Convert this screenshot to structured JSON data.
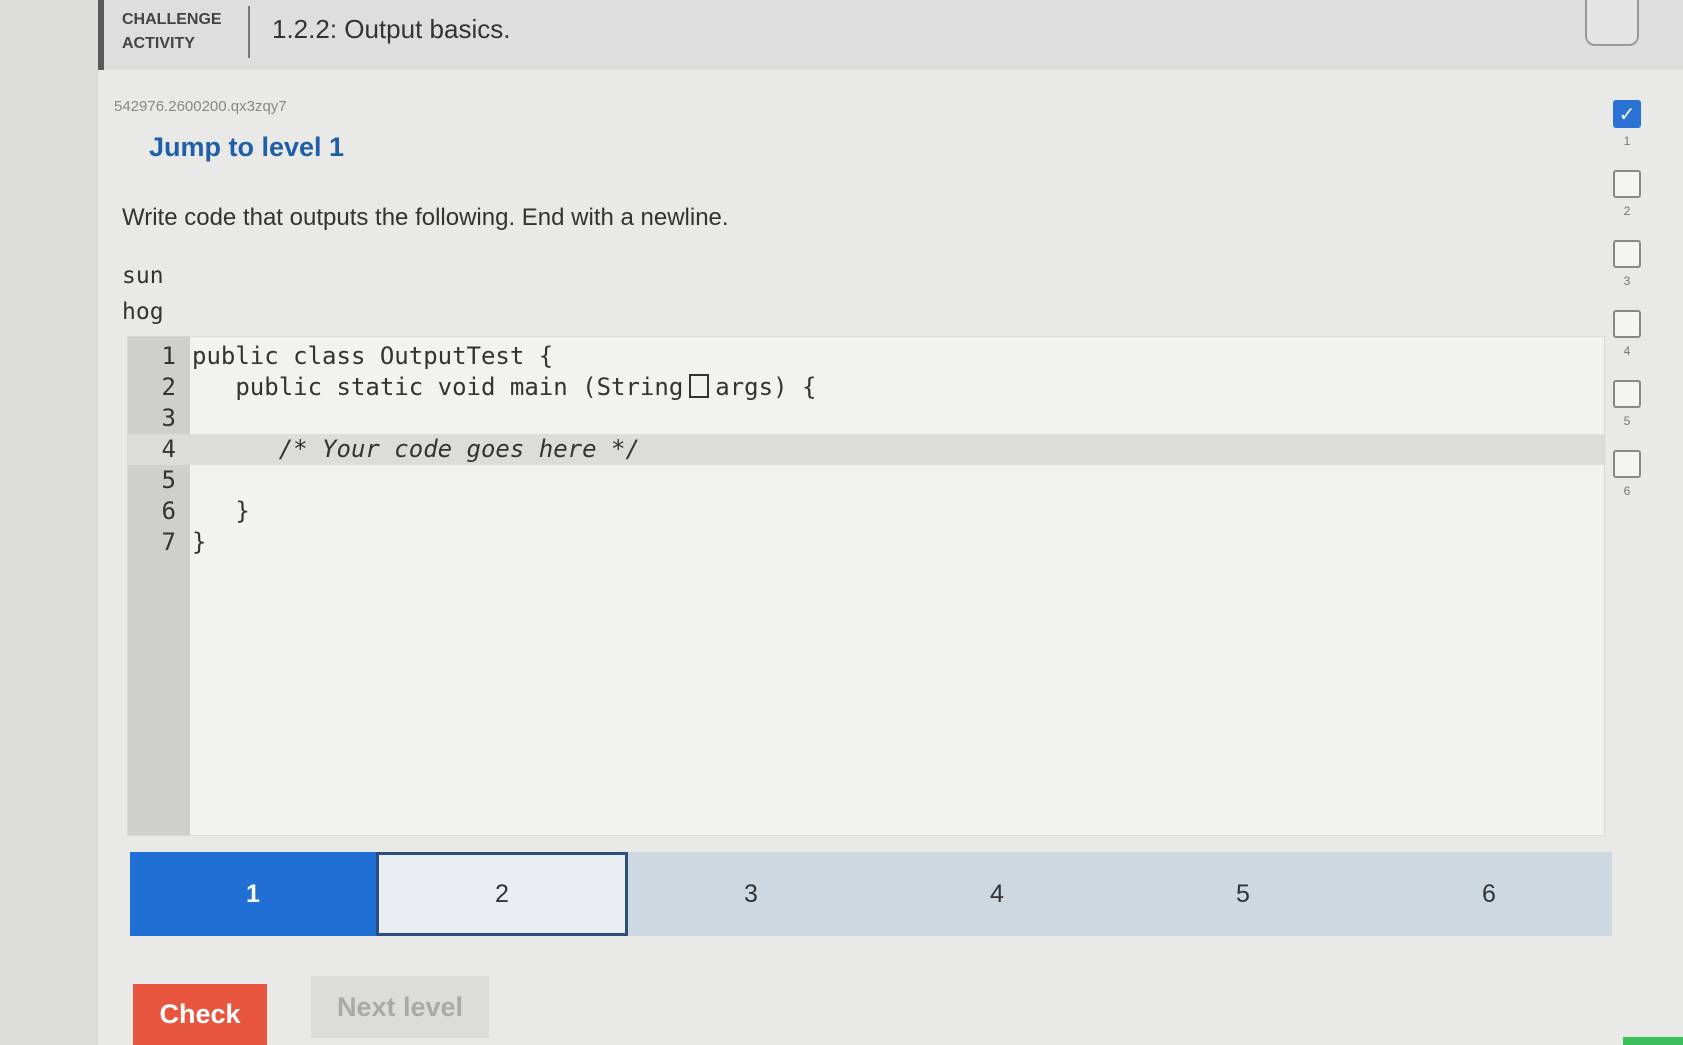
{
  "header": {
    "kind": "CHALLENGE ACTIVITY",
    "title": "1.2.2: Output basics."
  },
  "activity_id": "542976.2600200.qx3zqy7",
  "jump_label": "Jump to level 1",
  "instructions": "Write code that outputs the following. End with a newline.",
  "expected_output": [
    "sun",
    "hog"
  ],
  "editor": {
    "lines": [
      {
        "num": "1",
        "code": "public class OutputTest {"
      },
      {
        "num": "2",
        "code": "   public static void main (String",
        "after": "args) {"
      },
      {
        "num": "3",
        "code": ""
      },
      {
        "num": "4",
        "code": "      /* Your code goes here */"
      },
      {
        "num": "5",
        "code": ""
      },
      {
        "num": "6",
        "code": "   }"
      },
      {
        "num": "7",
        "code": "}"
      }
    ]
  },
  "levels": [
    "1",
    "2",
    "3",
    "4",
    "5",
    "6"
  ],
  "current_level": "1",
  "buttons": {
    "check": "Check",
    "next": "Next level"
  },
  "progress": [
    {
      "num": "1",
      "done": true,
      "mark": "✓"
    },
    {
      "num": "2",
      "done": false,
      "mark": ""
    },
    {
      "num": "3",
      "done": false,
      "mark": ""
    },
    {
      "num": "4",
      "done": false,
      "mark": ""
    },
    {
      "num": "5",
      "done": false,
      "mark": ""
    },
    {
      "num": "6",
      "done": false,
      "mark": ""
    }
  ],
  "colors": {
    "accent": "#1f6fd4",
    "check": "#e8553f",
    "title_blue": "#1f5fa8"
  }
}
